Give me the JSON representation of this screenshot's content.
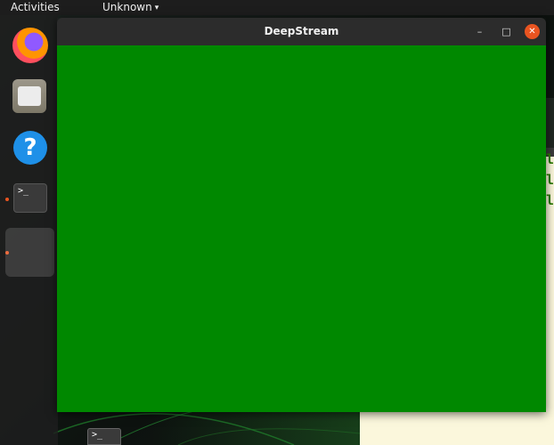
{
  "topbar": {
    "activities_label": "Activities",
    "app_menu_label": "Unknown",
    "app_menu_caret": "▾"
  },
  "dock": {
    "items": [
      {
        "name": "Firefox",
        "icon": "firefox-icon",
        "running": false
      },
      {
        "name": "Files",
        "icon": "files-icon",
        "running": false
      },
      {
        "name": "Help",
        "icon": "help-icon",
        "glyph": "?",
        "running": false
      },
      {
        "name": "Terminal",
        "icon": "terminal-icon",
        "glyph": ">_",
        "running": true
      },
      {
        "name": "DeepStream",
        "icon": "blank-app-icon",
        "running": true,
        "active": true
      }
    ]
  },
  "main_window": {
    "title": "DeepStream",
    "minimize_glyph": "–",
    "maximize_glyph": "□",
    "close_glyph": "✕",
    "content_color": "#008800"
  },
  "background_window": {
    "lines": [
      "le",
      "le",
      "le"
    ],
    "text_color": "#2e7d06",
    "background_color": "#fbf7dc"
  },
  "bottom_terminal": {
    "glyph": ">_"
  },
  "colors": {
    "accent": "#e95420",
    "topbar": "#1d1d1d",
    "titlebar": "#2c2c2c"
  }
}
